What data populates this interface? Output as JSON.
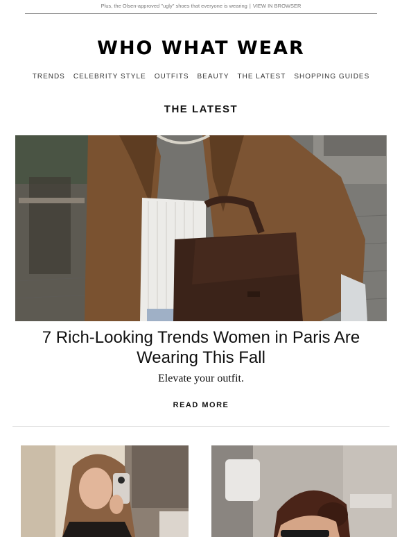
{
  "preheader": {
    "text": "Plus, the Olsen-approved \"ugly\" shoes that everyone is wearing",
    "separator": "|",
    "link": "VIEW IN BROWSER"
  },
  "brand": {
    "logo": "WHO WHAT WEAR"
  },
  "nav": {
    "items": [
      "TRENDS",
      "CELEBRITY STYLE",
      "OUTFITS",
      "BEAUTY",
      "THE LATEST",
      "SHOPPING GUIDES"
    ]
  },
  "section": {
    "title": "THE LATEST"
  },
  "featured": {
    "headline": "7 Rich-Looking Trends Women in Paris Are Wearing This Fall",
    "subhead": "Elevate your outfit.",
    "cta": "READ MORE"
  },
  "colors": {
    "accent": "#000000",
    "jacket": "#7a5230",
    "bag": "#3b2319",
    "text_muted": "#777777"
  }
}
